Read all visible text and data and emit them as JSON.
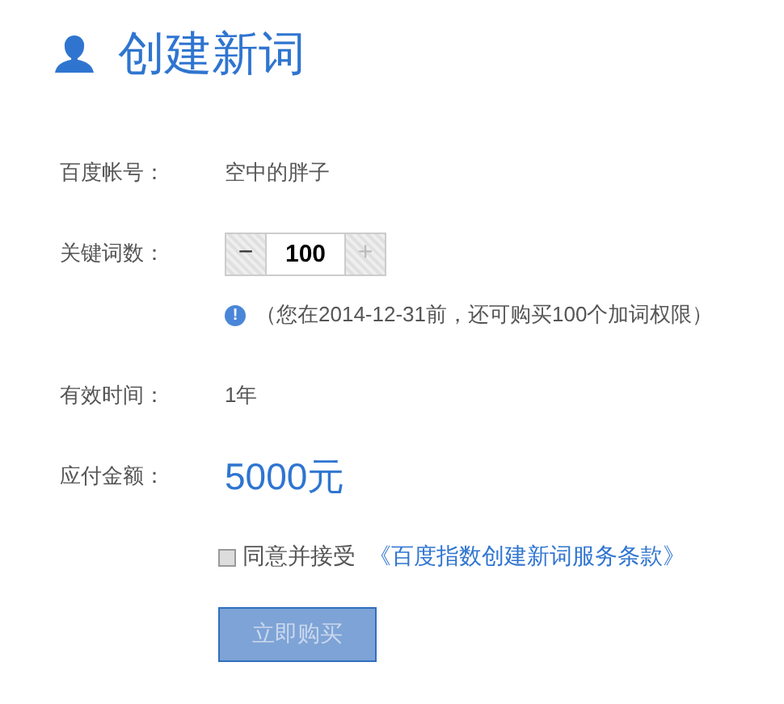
{
  "title": "创建新词",
  "account": {
    "label": "百度帐号：",
    "value": "空中的胖子"
  },
  "keywords": {
    "label": "关键词数：",
    "minus": "−",
    "value": "100",
    "plus": "+",
    "minus_disabled": false,
    "plus_disabled": true
  },
  "notice": {
    "icon": "!",
    "text": "（您在2014-12-31前，还可购买100个加词权限）"
  },
  "validity": {
    "label": "有效时间：",
    "value": "1年"
  },
  "amount": {
    "label": "应付金额：",
    "value": "5000元"
  },
  "agreement": {
    "checked": false,
    "text": "同意并接受",
    "link": "《百度指数创建新词服务条款》"
  },
  "buy_button": {
    "label": "立即购买",
    "disabled": true
  }
}
